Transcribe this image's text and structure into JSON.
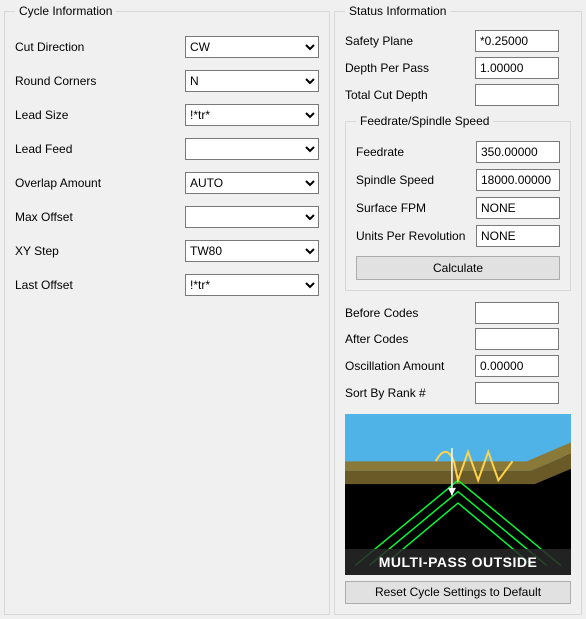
{
  "cycle": {
    "legend": "Cycle Information",
    "fields": {
      "cut_direction": {
        "label": "Cut Direction",
        "value": "CW"
      },
      "round_corners": {
        "label": "Round Corners",
        "value": "N"
      },
      "lead_size": {
        "label": "Lead Size",
        "value": "!*tr*"
      },
      "lead_feed": {
        "label": "Lead Feed",
        "value": ""
      },
      "overlap_amount": {
        "label": "Overlap Amount",
        "value": "AUTO"
      },
      "max_offset": {
        "label": "Max Offset",
        "value": ""
      },
      "xy_step": {
        "label": "XY Step",
        "value": "TW80"
      },
      "last_offset": {
        "label": "Last Offset",
        "value": "!*tr*"
      }
    }
  },
  "status": {
    "legend": "Status Information",
    "safety_plane": {
      "label": "Safety Plane",
      "value": "*0.25000"
    },
    "depth_per_pass": {
      "label": "Depth Per Pass",
      "value": "1.00000"
    },
    "total_cut_depth": {
      "label": "Total Cut Depth",
      "value": ""
    },
    "feedrate_group": {
      "legend": "Feedrate/Spindle Speed",
      "feedrate": {
        "label": "Feedrate",
        "value": "350.00000"
      },
      "spindle_speed": {
        "label": "Spindle Speed",
        "value": "18000.00000"
      },
      "surface_fpm": {
        "label": "Surface FPM",
        "value": "NONE"
      },
      "units_per_rev": {
        "label": "Units Per Revolution",
        "value": "NONE"
      },
      "calculate_label": "Calculate"
    },
    "before_codes": {
      "label": "Before Codes",
      "value": ""
    },
    "after_codes": {
      "label": "After Codes",
      "value": ""
    },
    "oscillation_amount": {
      "label": "Oscillation Amount",
      "value": "0.00000"
    },
    "sort_by_rank": {
      "label": "Sort By Rank #",
      "value": ""
    },
    "preview_caption": "MULTI-PASS OUTSIDE",
    "reset_label": "Reset Cycle Settings to Default"
  }
}
